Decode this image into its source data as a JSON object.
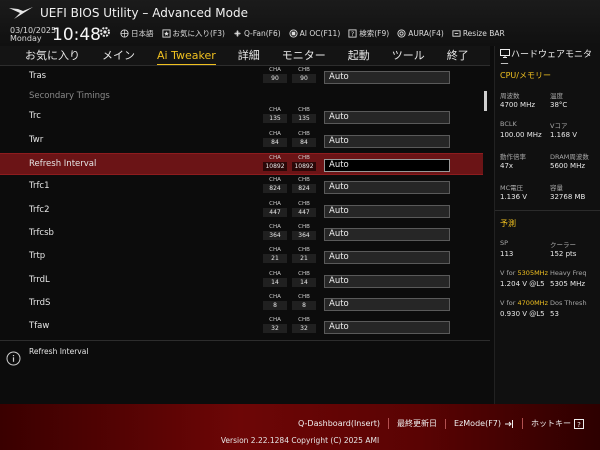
{
  "header": {
    "title": "UEFI BIOS Utility – Advanced Mode",
    "date": "03/10/2025",
    "day": "Monday",
    "time": "10:48",
    "toolbar": [
      {
        "label": "日本語",
        "icon": "globe-icon"
      },
      {
        "label": "お気に入り(F3)",
        "icon": "star-icon"
      },
      {
        "label": "Q-Fan(F6)",
        "icon": "fan-icon"
      },
      {
        "label": "AI OC(F11)",
        "icon": "ai-oc-icon"
      },
      {
        "label": "検索(F9)",
        "icon": "help-icon"
      },
      {
        "label": "AURA(F4)",
        "icon": "aura-icon"
      },
      {
        "label": "Resize BAR",
        "icon": "resize-bar-icon"
      }
    ]
  },
  "tabs": [
    "お気に入り",
    "メイン",
    "Ai Tweaker",
    "詳細",
    "モニター",
    "起動",
    "ツール",
    "終了"
  ],
  "active_tab": "Ai Tweaker",
  "rows": [
    {
      "label": "Tras",
      "cha": "90",
      "chb": "90",
      "value": "Auto"
    },
    {
      "label": "Secondary Timings",
      "section": true
    },
    {
      "label": "Trc",
      "cha": "135",
      "chb": "135",
      "value": "Auto"
    },
    {
      "label": "Twr",
      "cha": "84",
      "chb": "84",
      "value": "Auto"
    },
    {
      "label": "Refresh Interval",
      "cha": "10892",
      "chb": "10892",
      "value": "Auto",
      "selected": true
    },
    {
      "label": "Trfc1",
      "cha": "824",
      "chb": "824",
      "value": "Auto"
    },
    {
      "label": "Trfc2",
      "cha": "447",
      "chb": "447",
      "value": "Auto"
    },
    {
      "label": "Trfcsb",
      "cha": "364",
      "chb": "364",
      "value": "Auto"
    },
    {
      "label": "Trtp",
      "cha": "21",
      "chb": "21",
      "value": "Auto"
    },
    {
      "label": "TrrdL",
      "cha": "14",
      "chb": "14",
      "value": "Auto"
    },
    {
      "label": "TrrdS",
      "cha": "8",
      "chb": "8",
      "value": "Auto"
    },
    {
      "label": "Tfaw",
      "cha": "32",
      "chb": "32",
      "value": "Auto"
    }
  ],
  "channel_labels": {
    "a": "CHA",
    "b": "CHB"
  },
  "help_text": "Refresh Interval",
  "hw_monitor": {
    "title": "ハードウェアモニター",
    "cpu_section": "CPU/メモリー",
    "items": [
      {
        "label": "周波数",
        "value": "4700 MHz"
      },
      {
        "label": "温度",
        "value": "38°C"
      },
      {
        "label": "BCLK",
        "value": "100.00 MHz"
      },
      {
        "label": "Vコア",
        "value": "1.168 V"
      },
      {
        "label": "動作倍率",
        "value": "47x"
      },
      {
        "label": "DRAM周波数",
        "value": "5600 MHz"
      },
      {
        "label": "MC電圧",
        "value": "1.136 V"
      },
      {
        "label": "容量",
        "value": "32768 MB"
      }
    ],
    "predict_section": "予測",
    "sp_label": "SP",
    "sp_value": "113",
    "cooler_label": "クーラー",
    "cooler_value": "152 pts",
    "v1_prefix": "V for ",
    "v1_freq": "5305MHz",
    "v1_value": "1.204 V @L5",
    "heavy_label": "Heavy Freq",
    "heavy_value": "5305 MHz",
    "v2_prefix": "V for ",
    "v2_freq": "4700MHz",
    "v2_value": "0.930 V @L5",
    "dos_label": "Dos Thresh",
    "dos_value": "53"
  },
  "footer": {
    "qdashboard": "Q-Dashboard(Insert)",
    "last_modified": "最終更新日",
    "ezmode": "EzMode(F7)",
    "hotkeys": "ホットキー",
    "version": "Version 2.22.1284 Copyright (C) 2025 AMI"
  },
  "colors": {
    "accent": "#f0c020",
    "selected_row": "#6b1416",
    "footer": "#6d0606"
  }
}
